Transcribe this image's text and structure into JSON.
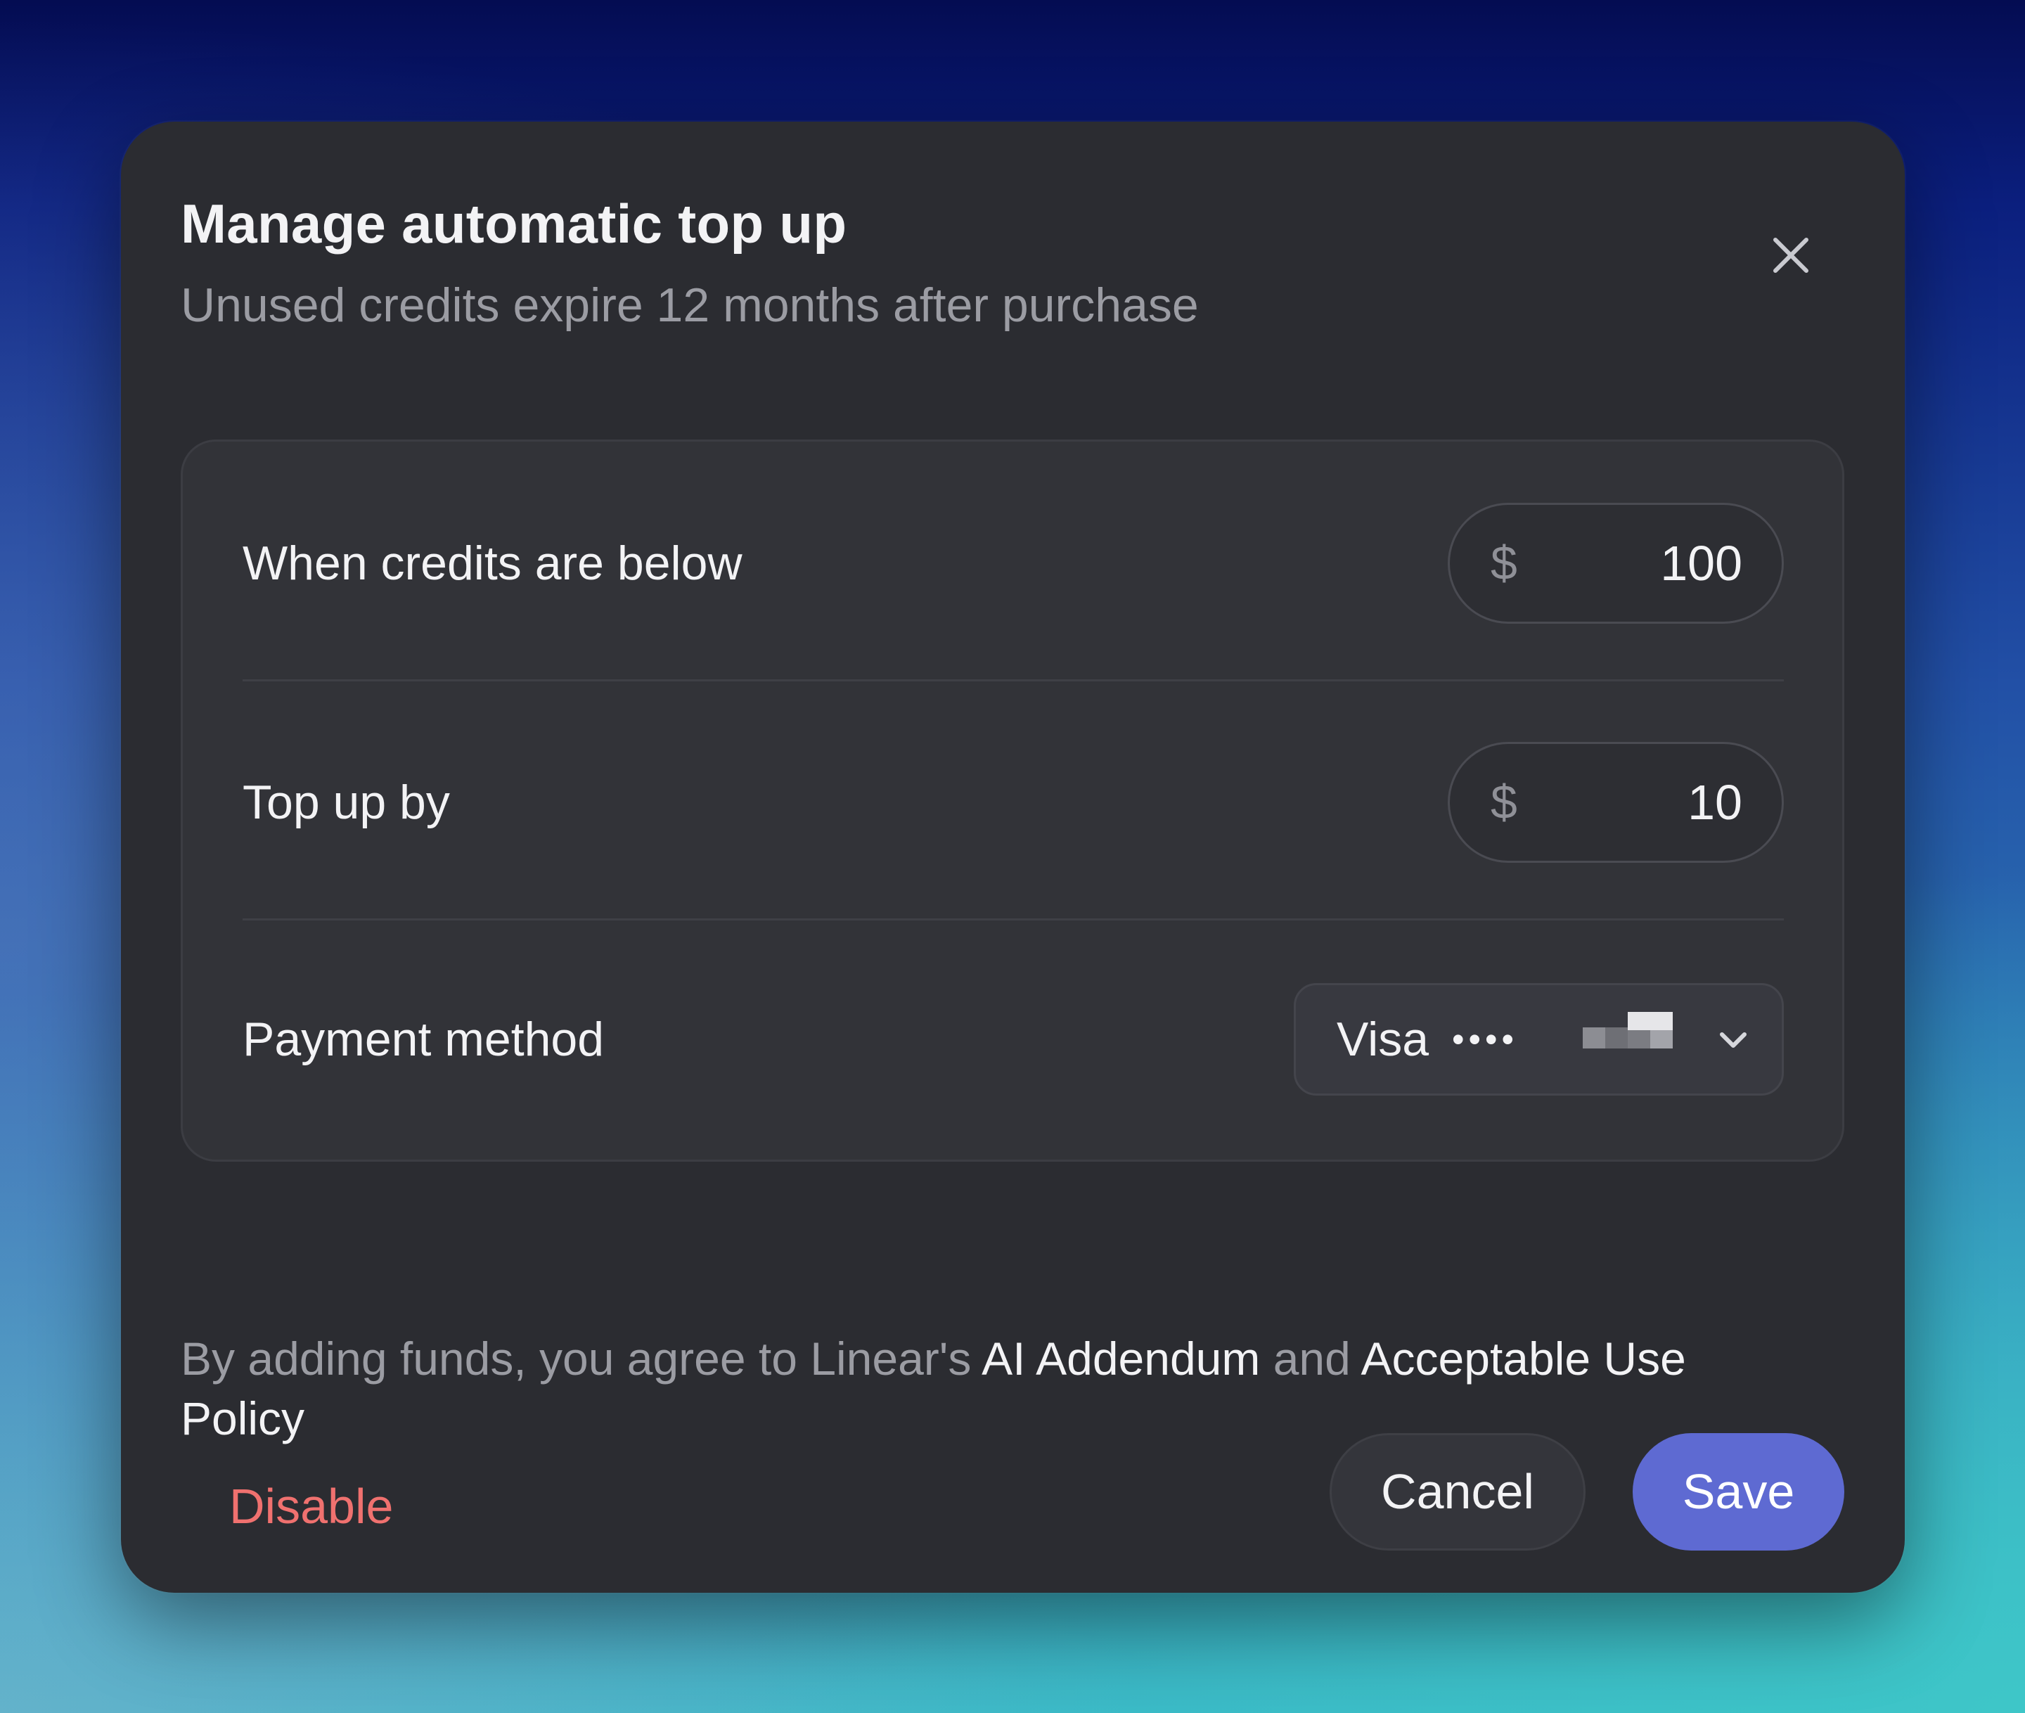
{
  "dialog": {
    "title": "Manage automatic top up",
    "subtitle": "Unused credits expire 12 months after purchase",
    "close_icon": "close-icon"
  },
  "settings": {
    "threshold": {
      "label": "When credits are below",
      "currency": "$",
      "value": "100"
    },
    "top_up": {
      "label": "Top up by",
      "currency": "$",
      "value": "10"
    },
    "payment_method": {
      "label": "Payment method",
      "card_brand": "Visa",
      "masked_dots": "••••",
      "last4_redacted": true,
      "dropdown_icon": "chevron-down-icon"
    }
  },
  "terms": {
    "prefix": "By adding funds, you agree to Linear's ",
    "ai_addendum_link": "AI Addendum",
    "middle": " and ",
    "acceptable_use_link_part1": "Acceptable Use",
    "acceptable_use_link_part2": "Policy"
  },
  "footer": {
    "disable_label": "Disable",
    "cancel_label": "Cancel",
    "save_label": "Save"
  },
  "colors": {
    "accent": "#5e6ad2",
    "danger": "#f0716f",
    "dialog_background": "#2b2c31",
    "card_background": "#323338"
  }
}
